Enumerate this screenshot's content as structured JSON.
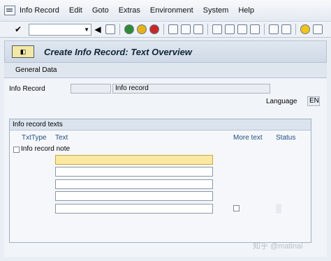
{
  "menu": [
    "Info Record",
    "Edit",
    "Goto",
    "Extras",
    "Environment",
    "System",
    "Help"
  ],
  "toolbar": {
    "command_value": ""
  },
  "page_title": "Create Info Record: Text Overview",
  "app_toolbar": {
    "general_data": "General Data"
  },
  "header": {
    "info_record_label": "Info Record",
    "info_record_number": "",
    "info_record_desc": "Info record",
    "language_label": "Language",
    "language_value": "EN"
  },
  "texts_group": {
    "title": "Info record texts",
    "columns": {
      "txt_type": "TxtType",
      "text": "Text",
      "more_text": "More text",
      "status": "Status"
    },
    "row_label": "Info record note"
  },
  "watermark": "知乎 @matinal"
}
